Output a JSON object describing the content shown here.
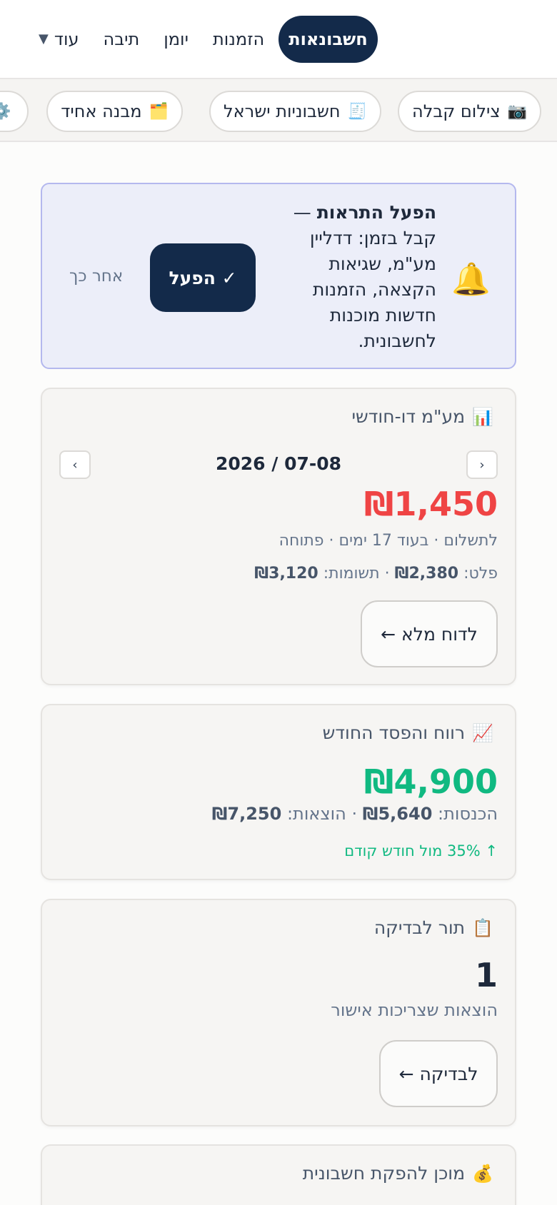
{
  "nav": {
    "more": "עוד",
    "items": [
      "תיבה",
      "יומן",
      "הזמנות",
      "חשבונאות"
    ],
    "active": "חשבונאות"
  },
  "shortcuts": [
    {
      "emoji": "📷",
      "label": "צילום קבלה"
    },
    {
      "emoji": "🧾",
      "label": "חשבוניות ישראל"
    },
    {
      "emoji": "🗂️",
      "label": "מבנה אחיד"
    },
    {
      "emoji": "⚙️",
      "label": ""
    }
  ],
  "alert": {
    "title": "הפעל התראות",
    "dash": "—",
    "body": "קבל בזמן: דדליין מע\"מ, שגיאות הקצאה, הזמנות חדשות מוכנות לחשבונית.",
    "activate": "✓ הפעל",
    "later": "אחר כך"
  },
  "vat": {
    "emoji": "📊",
    "title": "מע\"מ דו-חודשי",
    "period": "2026 / 07-08",
    "prev": "‹",
    "next": "›",
    "amount": "₪1,450",
    "status": "לתשלום · בעוד 17 ימים · פתוחה",
    "output_label": "פלט:",
    "output_value": "₪2,380",
    "sep": "·",
    "input_label": "תשומות:",
    "input_value": "₪3,120",
    "report_button": "לדוח מלא ←",
    "amount_color": "#ef4444"
  },
  "pnl": {
    "emoji": "📈",
    "title": "רווח והפסד החודש",
    "amount": "₪4,900",
    "income_label": "הכנסות:",
    "income_value": "₪5,640",
    "sep": "·",
    "expense_label": "הוצאות:",
    "expense_value": "₪7,250",
    "trend": "↑ 35% מול חודש קודם",
    "amount_color": "#10b981"
  },
  "review": {
    "emoji": "📋",
    "title": "תור לבדיקה",
    "count": "1",
    "subtitle": "הוצאות שצריכות אישור",
    "button": "לבדיקה ←"
  },
  "invoice": {
    "emoji": "💰",
    "title": "מוכן להפקת חשבונית"
  }
}
